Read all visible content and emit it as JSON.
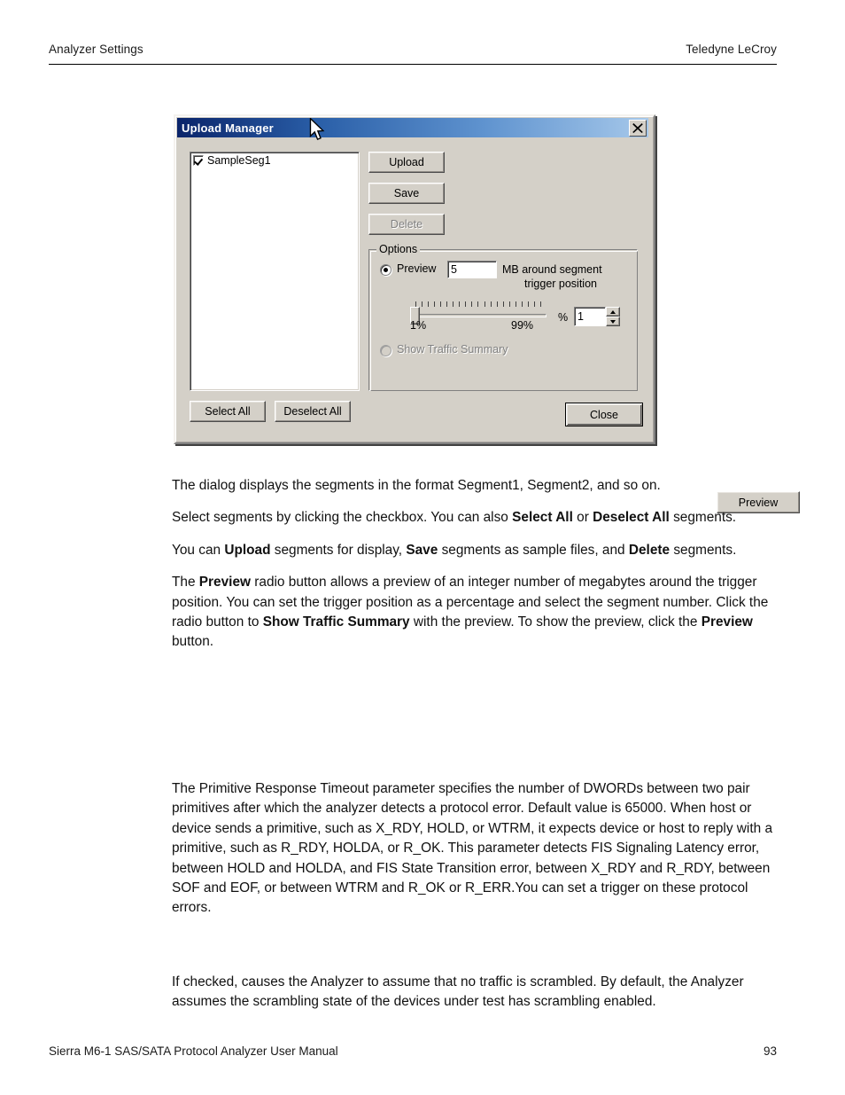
{
  "header": {
    "left": "Analyzer Settings",
    "right": "Teledyne LeCroy"
  },
  "footer": {
    "left": "Sierra M6-1 SAS/SATA Protocol Analyzer User Manual",
    "page_number": "93"
  },
  "dialog": {
    "title": "Upload Manager",
    "close_icon": "close-icon",
    "cursor_icon": "mouse-pointer-icon",
    "listbox": {
      "items": [
        {
          "label": "SampleSeg1",
          "checked": true
        }
      ]
    },
    "buttons": {
      "upload": "Upload",
      "save": "Save",
      "delete": "Delete",
      "delete_disabled": true,
      "preview": "Preview",
      "select_all": "Select All",
      "deselect_all": "Deselect All",
      "close": "Close"
    },
    "options": {
      "group_title": "Options",
      "preview_radio": {
        "label": "Preview",
        "selected": true
      },
      "preview_mb_value": "5",
      "mb_caption_line1": "MB around segment",
      "mb_caption_line2": "trigger position",
      "trackbar": {
        "min_label": "1%",
        "max_label": "99%",
        "tick_count": 21,
        "thumb_position_percent": 1
      },
      "percent_sign": "%",
      "segment_number_value": "1",
      "spinner_up_icon": "chevron-up-icon",
      "spinner_down_icon": "chevron-down-icon",
      "show_traffic_summary_radio": {
        "label": "Show Traffic Summary",
        "selected": false,
        "disabled": true
      }
    }
  },
  "body": {
    "paragraphs_block_1": [
      {
        "runs": [
          {
            "text": "The dialog displays the segments in the format Segment1, Segment2, and so on.",
            "bold": false
          }
        ]
      },
      {
        "runs": [
          {
            "text": "Select segments by clicking the checkbox. You can also ",
            "bold": false
          },
          {
            "text": "Select All",
            "bold": true
          },
          {
            "text": " or ",
            "bold": false
          },
          {
            "text": "Deselect All",
            "bold": true
          },
          {
            "text": " segments.",
            "bold": false
          }
        ]
      },
      {
        "runs": [
          {
            "text": "You can ",
            "bold": false
          },
          {
            "text": "Upload",
            "bold": true
          },
          {
            "text": " segments for display, ",
            "bold": false
          },
          {
            "text": "Save",
            "bold": true
          },
          {
            "text": " segments as sample files, and ",
            "bold": false
          },
          {
            "text": "Delete",
            "bold": true
          },
          {
            "text": " segments.",
            "bold": false
          }
        ]
      },
      {
        "runs": [
          {
            "text": "The ",
            "bold": false
          },
          {
            "text": "Preview",
            "bold": true
          },
          {
            "text": " radio button allows a preview of an integer number of megabytes around the trigger position. You can set the trigger position as a percentage and select the segment number. Click the radio button to ",
            "bold": false
          },
          {
            "text": "Show Traffic Summary",
            "bold": true
          },
          {
            "text": " with the preview. To show the preview, click the ",
            "bold": false
          },
          {
            "text": "Preview",
            "bold": true
          },
          {
            "text": " button.",
            "bold": false
          }
        ]
      }
    ],
    "paragraphs_block_2": [
      {
        "runs": [
          {
            "text": "The Primitive Response Timeout parameter specifies the number of DWORDs between two pair primitives after which the analyzer detects a protocol error. Default value is 65000. When host or device sends a primitive, such as X_RDY, HOLD, or WTRM, it expects device or host to reply with a primitive, such as R_RDY, HOLDA, or R_OK. This parameter detects FIS Signaling Latency error, between HOLD and HOLDA, and FIS State Transition error, between X_RDY and R_RDY, between SOF and EOF, or between WTRM and R_OK or R_ERR.You can set a trigger on these protocol errors.",
            "bold": false
          }
        ]
      }
    ],
    "paragraphs_block_3": [
      {
        "runs": [
          {
            "text": "If checked, causes the Analyzer to assume that no traffic is scrambled. By default, the Analyzer assumes the scrambling state of the devices under test has scrambling enabled.",
            "bold": false
          }
        ]
      }
    ]
  }
}
